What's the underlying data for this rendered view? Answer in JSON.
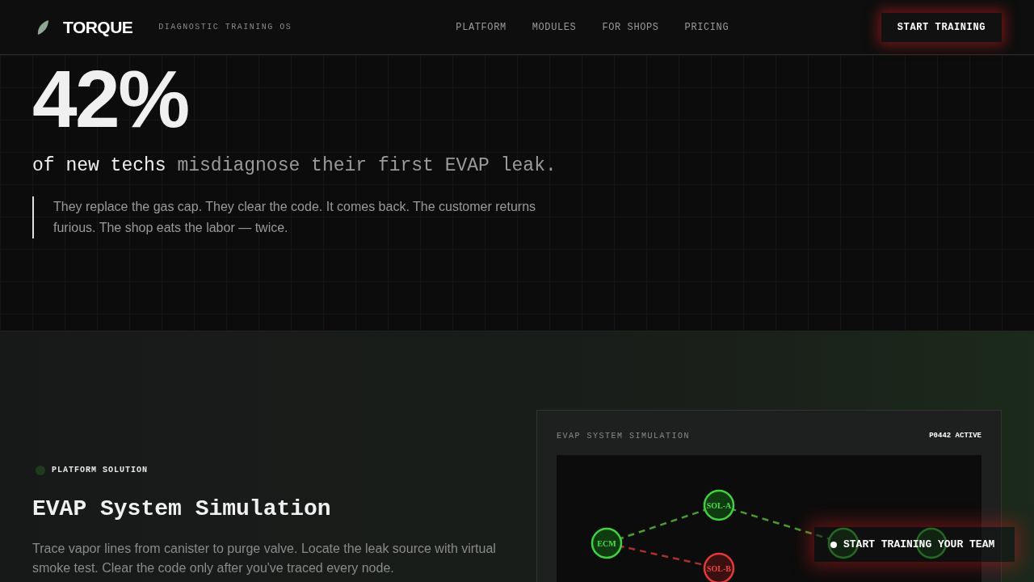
{
  "header": {
    "brand": "TORQUE",
    "tagline": "DIAGNOSTIC TRAINING OS",
    "nav": [
      {
        "label": "PLATFORM"
      },
      {
        "label": "MODULES"
      },
      {
        "label": "FOR SHOPS"
      },
      {
        "label": "PRICING"
      }
    ],
    "cta": "START TRAINING"
  },
  "hero": {
    "stat": "42%",
    "lead": "of new techs",
    "lead_rest": "misdiagnose their first EVAP leak.",
    "quote": "They replace the gas cap. They clear the code. It comes back. The customer returns furious. The shop eats the labor — twice."
  },
  "solution": {
    "eyebrow": "PLATFORM SOLUTION",
    "title": "EVAP System Simulation",
    "body": "Trace vapor lines from canister to purge valve. Locate the leak source with virtual smoke test. Clear the code only after you've traced every node."
  },
  "simulation": {
    "title": "EVAP SYSTEM SIMULATION",
    "code": "P0442 ACTIVE",
    "nodes": [
      {
        "label": "ECM",
        "fault": false
      },
      {
        "label": "SOL-A",
        "fault": false
      },
      {
        "fault": false
      },
      {
        "fault": false
      },
      {
        "label": "SOL-B",
        "fault": true
      }
    ],
    "links": [
      {
        "fault": false
      },
      {
        "fault": false
      },
      {
        "fault": true
      }
    ]
  },
  "floating_cta": "START TRAINING YOUR TEAM"
}
